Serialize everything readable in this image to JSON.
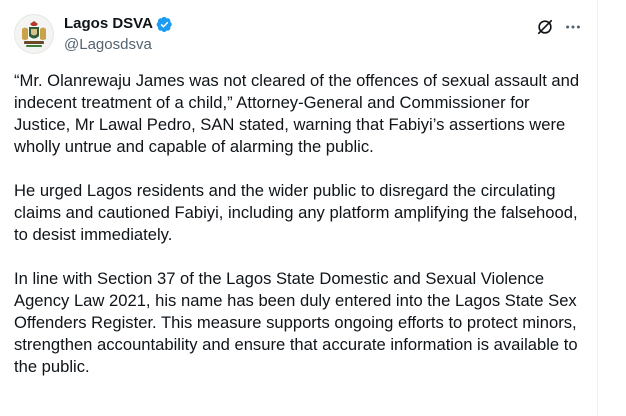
{
  "account": {
    "display_name": "Lagos DSVA",
    "handle": "@Lagosdsva",
    "verified": true
  },
  "header_actions": {
    "grok_icon": "grok-icon",
    "more_icon": "more-icon"
  },
  "tweet": {
    "paragraphs": [
      "“Mr. Olanrewaju James was not cleared of the offences of sexual assault and indecent treatment of a child,” Attorney-General and Commissioner for Justice, Mr Lawal Pedro, SAN stated, warning that Fabiyi’s assertions were wholly untrue and capable of alarming the public.",
      "He urged Lagos residents and the wider public to disregard the circulating claims and cautioned Fabiyi, including any platform amplifying the falsehood, to desist immediately.",
      "In line with Section 37 of the Lagos State Domestic and Sexual Violence Agency Law 2021, his name has been duly entered into the Lagos State Sex Offenders Register. This measure supports ongoing efforts to protect minors, strengthen accountability and ensure that accurate information is available to the public."
    ]
  },
  "colors": {
    "verified_badge": "#1d9bf0",
    "secondary_text": "#536471",
    "primary_text": "#0f1419"
  }
}
